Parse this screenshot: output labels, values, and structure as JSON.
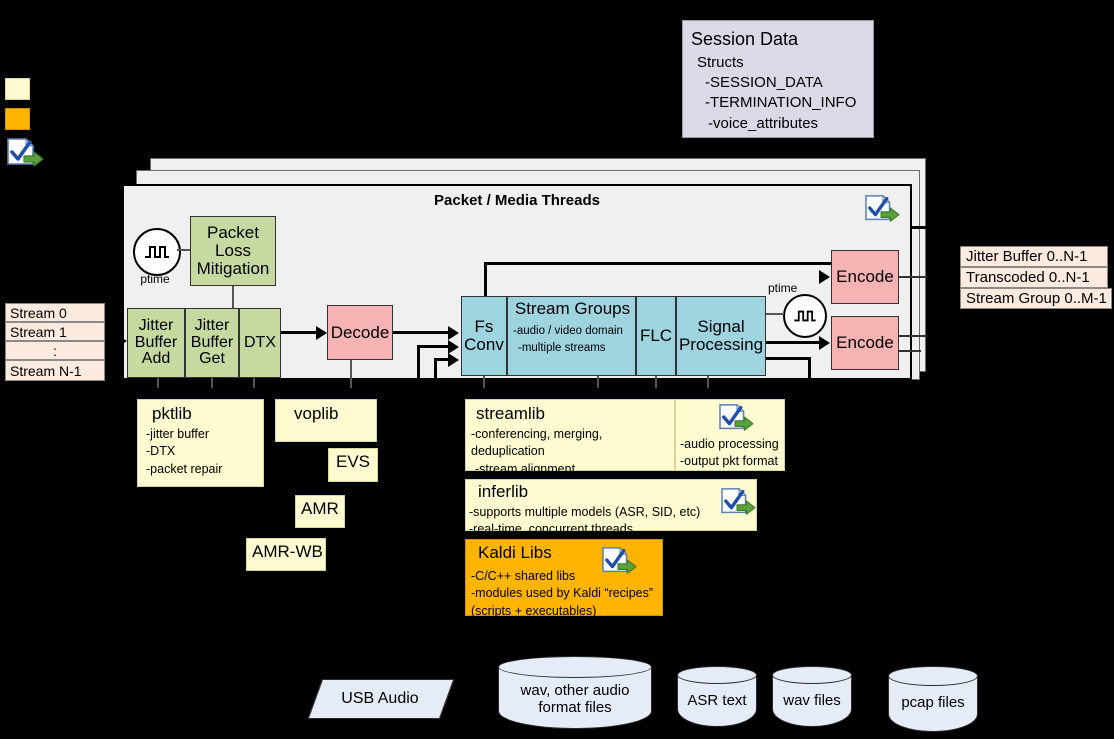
{
  "legend": {
    "items": [
      {
        "name": "pale-yellow-swatch",
        "color": "#fdfbcf"
      },
      {
        "name": "orange-swatch",
        "color": "#ffb400"
      },
      {
        "name": "doc-check-arrow-icon",
        "label": ""
      }
    ]
  },
  "session_data": {
    "title": "Session Data",
    "subtitle": "Structs",
    "items": [
      "-SESSION_DATA",
      "-TERMINATION_INFO",
      "-voice_attributes"
    ],
    "color": "#ddd8e6"
  },
  "streams": {
    "rows": [
      "Stream 0",
      "Stream 1",
      ":",
      "Stream N-1"
    ]
  },
  "panel": {
    "title": "Packet / Media Threads"
  },
  "blocks": {
    "ptime_left_label": "ptime",
    "ptime_right_label": "ptime",
    "packet_loss_mitigation": "Packet\nLoss\nMitigation",
    "jitter_buffer_add": "Jitter\nBuffer\nAdd",
    "jitter_buffer_get": "Jitter\nBuffer\nGet",
    "dtx": "DTX",
    "decode": "Decode",
    "fs_conv": "Fs\nConv",
    "stream_groups_title": "Stream Groups",
    "stream_groups_lines": [
      "-audio / video domain",
      "-multiple streams"
    ],
    "flc": "FLC",
    "signal_processing": "Signal\nProcessing",
    "encode_top": "Encode",
    "encode_bottom": "Encode"
  },
  "buffers": {
    "rows": [
      "Jitter Buffer 0..N-1",
      "Transcoded 0..N-1",
      "Stream Group 0..M-1"
    ]
  },
  "libs": {
    "pktlib": {
      "title": "pktlib",
      "lines": [
        "-jitter buffer",
        "-DTX",
        "-packet repair"
      ]
    },
    "voplib": {
      "title": "voplib"
    },
    "evs": {
      "title": "EVS"
    },
    "amr": {
      "title": "AMR"
    },
    "amrwb": {
      "title": "AMR-WB"
    },
    "streamlib": {
      "title": "streamlib",
      "lines": [
        "-conferencing, merging, deduplication",
        "-stream alignment"
      ],
      "side_lines": [
        "-audio processing",
        "-output pkt format"
      ]
    },
    "inferlib": {
      "title": "inferlib",
      "lines": [
        "-supports multiple models (ASR, SID, etc)",
        "-real-time, concurrent threads"
      ]
    },
    "kaldi": {
      "title": "Kaldi Libs",
      "lines": [
        "-C/C++ shared libs",
        "-modules used by Kaldi “recipes”",
        " (scripts + executables)"
      ],
      "color": "#ffb400"
    }
  },
  "storage": {
    "usb_audio": "USB Audio",
    "wav_audio_files": "wav, other audio\nformat files",
    "asr_text": "ASR text",
    "wav_files": "wav files",
    "pcap_files": "pcap files"
  }
}
